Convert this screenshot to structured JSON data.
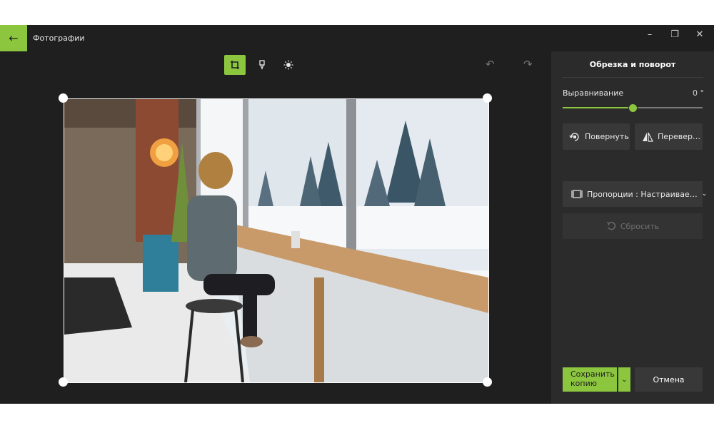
{
  "window": {
    "title": "Фотографии",
    "controls": {
      "minimize": "–",
      "restore": "❐",
      "close": "✕"
    }
  },
  "toolbar": {
    "icons": [
      "crop-rotate-icon",
      "filters-icon",
      "adjust-brightness-icon"
    ],
    "undo_icon": "undo-icon",
    "redo_icon": "redo-icon"
  },
  "panel": {
    "title": "Обрезка и поворот",
    "straighten": {
      "label": "Выравнивание",
      "value": "0 °",
      "slider_fraction": 0.5
    },
    "rotate_label": "Повернуть",
    "flip_label": "Перевер…",
    "aspect_label": "Пропорции : Настраивае…",
    "reset_label": "Сбросить"
  },
  "footer": {
    "save_label_line1": "Сохранить",
    "save_label_line2": "копию",
    "cancel_label": "Отмена"
  },
  "colors": {
    "accent": "#8cc63f",
    "app_bg": "#1f1f1f",
    "panel_bg": "#2b2b2b",
    "button_bg": "#383838"
  }
}
